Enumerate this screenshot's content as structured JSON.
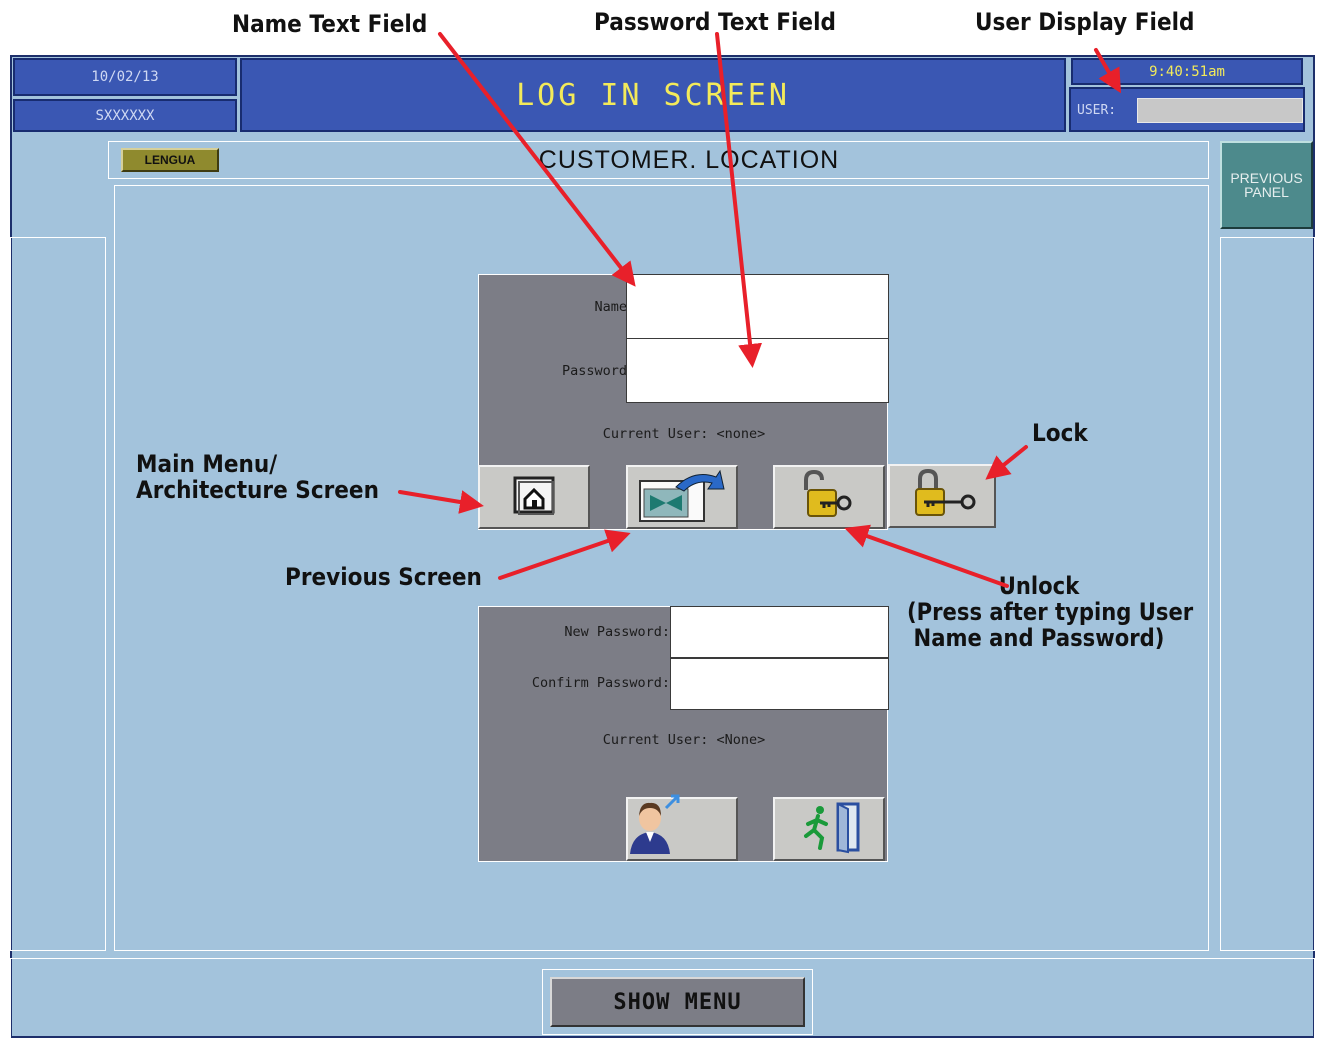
{
  "annotations": {
    "name_text_field": "Name Text Field",
    "password_text_field": "Password Text Field",
    "user_display_field": "User Display Field",
    "main_menu_line1": "Main Menu/",
    "main_menu_line2": "Architecture Screen",
    "previous_screen": "Previous Screen",
    "lock": "Lock",
    "unlock_line1": "Unlock",
    "unlock_line2": "(Press after typing User",
    "unlock_line3": "Name and Password)"
  },
  "header": {
    "date": "10/02/13",
    "system_id": "SXXXXXX",
    "title": "LOG IN SCREEN",
    "time": "9:40:51am",
    "user_label": "USER:",
    "user_value": ""
  },
  "toolbar": {
    "language_button": "LENGUA",
    "location": "CUSTOMER. LOCATION",
    "previous_panel_line1": "PREVIOUS",
    "previous_panel_line2": "PANEL"
  },
  "login": {
    "name_label": "Name",
    "name_value": "",
    "password_label": "Password",
    "password_value": "",
    "current_user": "Current User: <none>"
  },
  "change_password": {
    "new_password_label": "New Password:",
    "new_password_value": "",
    "confirm_password_label": "Confirm Password:",
    "confirm_password_value": "",
    "current_user": "Current User: <None>"
  },
  "footer": {
    "show_menu": "SHOW MENU"
  },
  "colors": {
    "screen_background": "#a3c3dc",
    "header_blue": "#3a57b3",
    "title_yellow": "#f3ea5a",
    "panel_gray": "#7c7d86",
    "annotation_arrow": "#e8202a",
    "previous_panel_teal": "#4d8a8c",
    "language_olive": "#8f8a2e"
  },
  "icons": [
    "home-icon",
    "previous-screen-arrow-icon",
    "unlock-padlock-icon",
    "lock-padlock-icon",
    "user-profile-icon",
    "logout-exit-icon"
  ]
}
